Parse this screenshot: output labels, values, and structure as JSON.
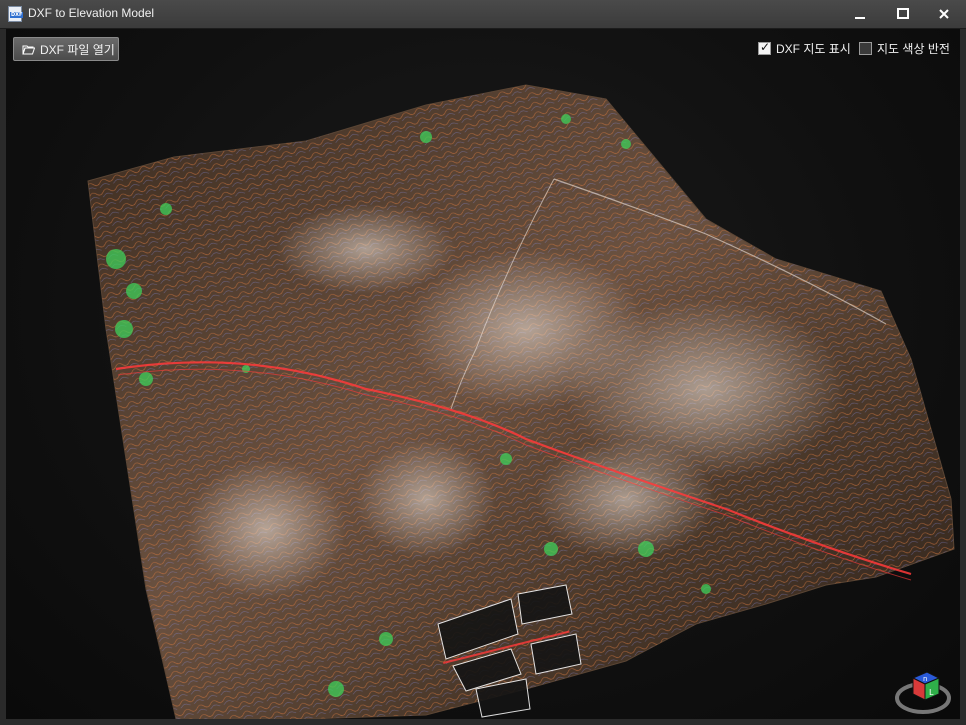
{
  "window": {
    "title": "DXF to Elevation Model",
    "minimize_glyph": "minimize-icon",
    "maximize_glyph": "maximize-icon",
    "close_glyph": "close-icon"
  },
  "toolbar": {
    "open_label": "DXF 파일 열기",
    "open_icon": "folder-open-icon"
  },
  "options": {
    "show_map": {
      "label": "DXF 지도 표시",
      "checked": true
    },
    "invert_colors": {
      "label": "지도 색상 반전",
      "checked": false
    }
  },
  "colors": {
    "titlebar": "#3f3f3f",
    "viewport_bg": "#111111",
    "terrain": "#5a4330",
    "contour_orange": "#e07a3a",
    "contour_blue": "#8f9cff",
    "vegetation": "#3fd05a",
    "road": "#ff3a3a"
  },
  "viewcube": {
    "icon": "navigation-cube-icon",
    "top_letter": "n",
    "front_letter": "L"
  }
}
